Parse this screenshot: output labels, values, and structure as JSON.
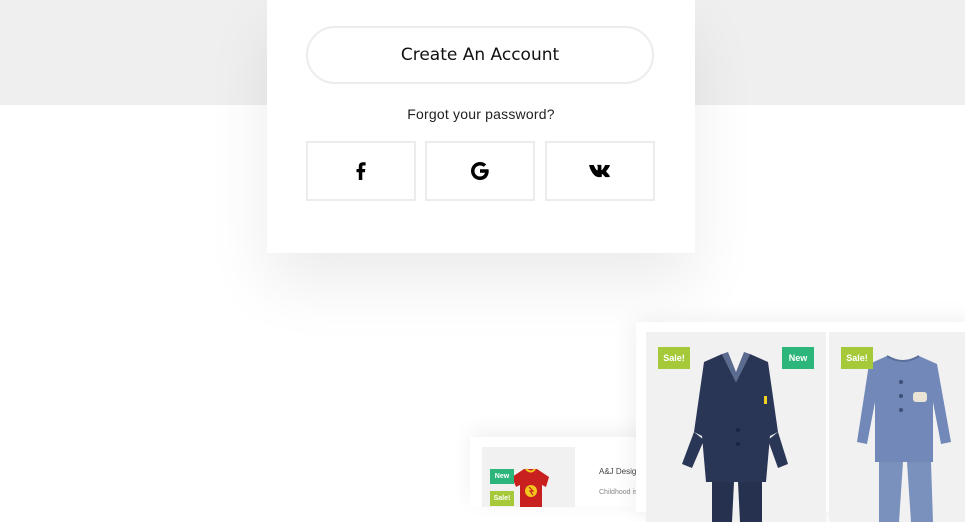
{
  "login": {
    "create_account_label": "Create An Account",
    "forgot_password_label": "Forgot your password?",
    "social": [
      {
        "name": "facebook",
        "icon": "facebook-icon"
      },
      {
        "name": "google",
        "icon": "google-icon"
      },
      {
        "name": "vk",
        "icon": "vk-icon"
      }
    ]
  },
  "preview": {
    "small_card": {
      "badge_new": "New",
      "badge_sale": "Sale!",
      "title": "A&J Desig",
      "desc": "Childhood is"
    },
    "products": [
      {
        "badges": [
          "Sale!",
          "New"
        ],
        "image": "navy-kids-suit"
      },
      {
        "badges": [
          "Sale!"
        ],
        "image": "blue-baby-set"
      }
    ]
  },
  "colors": {
    "band": "#efefef",
    "badge_new": "#2db67c",
    "badge_sale": "#a6c93a"
  }
}
